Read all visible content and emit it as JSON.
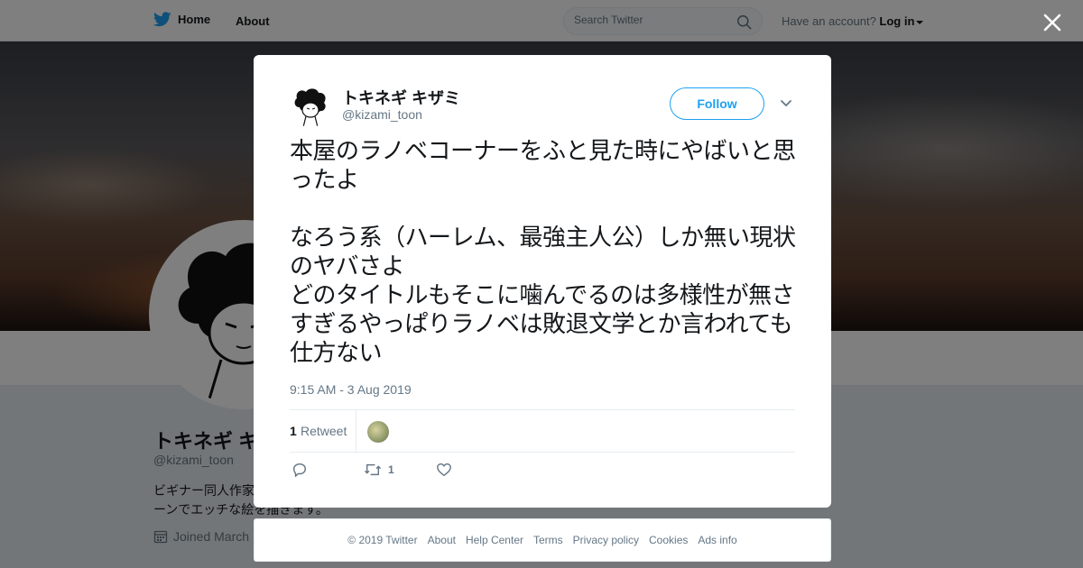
{
  "topbar": {
    "home_label": "Home",
    "about_label": "About",
    "search_placeholder": "Search Twitter",
    "account_prompt": "Have an account?",
    "login_label": "Log in"
  },
  "profile": {
    "name": "トキネギ キ",
    "handle": "@kizami_toon",
    "bio": "ビギナー同人作家\nーンでエッチな絵を描きます。",
    "joined": "Joined March"
  },
  "tweet": {
    "author_name": "トキネギ キザミ",
    "author_handle": "@kizami_toon",
    "follow_label": "Follow",
    "text": "本屋のラノベコーナーをふと見た時にやばいと思ったよ\n\nなろう系（ハーレム、最強主人公）しか無い現状のヤバさよ\nどのタイトルもそこに噛んでるのは多様性が無さすぎるやっぱりラノベは敗退文学とか言われても仕方ない",
    "timestamp": "9:15 AM - 3 Aug 2019",
    "retweet_count": "1",
    "retweet_label": "Retweet",
    "action_retweet_count": "1"
  },
  "footer": {
    "links": [
      "© 2019 Twitter",
      "About",
      "Help Center",
      "Terms",
      "Privacy policy",
      "Cookies",
      "Ads info"
    ]
  },
  "icons": {
    "twitter_bird": "twitter-bird-icon",
    "search": "search-icon",
    "close": "close-icon",
    "chevron": "chevron-down-icon",
    "reply": "reply-icon",
    "retweet": "retweet-icon",
    "like": "heart-icon",
    "calendar": "calendar-icon"
  },
  "colors": {
    "brand_blue": "#1da1f2",
    "muted_text": "#657786",
    "primary_text": "#14171a"
  }
}
